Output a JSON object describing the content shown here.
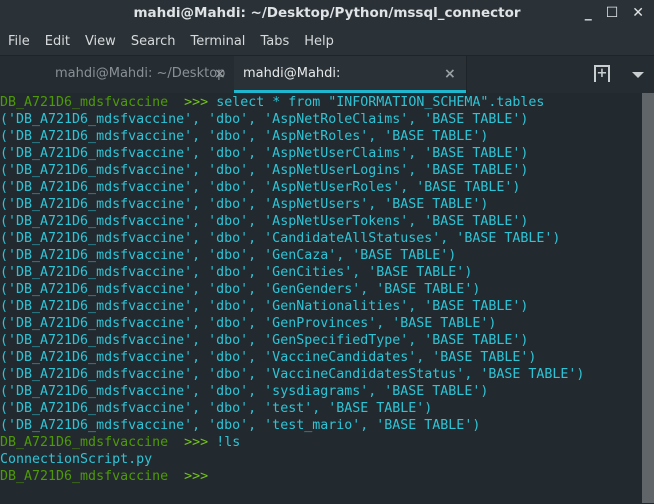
{
  "window": {
    "title": "mahdi@Mahdi: ~/Desktop/Python/mssql_connector",
    "minimize": "_",
    "maximize": "☐",
    "close": "✕"
  },
  "menu": [
    "File",
    "Edit",
    "View",
    "Search",
    "Terminal",
    "Tabs",
    "Help"
  ],
  "tabs": [
    {
      "label": "mahdi@Mahdi: ~/Desktop",
      "active": false
    },
    {
      "label": "mahdi@Mahdi: ~/Desktop/Python/...",
      "active": true
    }
  ],
  "tab_close": "×",
  "new_tab_icon": "+",
  "colors": {
    "prompt": "#4e9a06",
    "arrow": "#73c21e",
    "output": "#2ec4d6",
    "accent": "#1fb7cf",
    "background": "#232a2f"
  },
  "terminal": {
    "prompt": "DB_A721D6_mdsfvaccine",
    "arrow": ">>>",
    "command1": "select * from \"INFORMATION_SCHEMA\".tables",
    "rows": [
      "('DB_A721D6_mdsfvaccine', 'dbo', 'AspNetRoleClaims', 'BASE TABLE')",
      "('DB_A721D6_mdsfvaccine', 'dbo', 'AspNetRoles', 'BASE TABLE')",
      "('DB_A721D6_mdsfvaccine', 'dbo', 'AspNetUserClaims', 'BASE TABLE')",
      "('DB_A721D6_mdsfvaccine', 'dbo', 'AspNetUserLogins', 'BASE TABLE')",
      "('DB_A721D6_mdsfvaccine', 'dbo', 'AspNetUserRoles', 'BASE TABLE')",
      "('DB_A721D6_mdsfvaccine', 'dbo', 'AspNetUsers', 'BASE TABLE')",
      "('DB_A721D6_mdsfvaccine', 'dbo', 'AspNetUserTokens', 'BASE TABLE')",
      "('DB_A721D6_mdsfvaccine', 'dbo', 'CandidateAllStatuses', 'BASE TABLE')",
      "('DB_A721D6_mdsfvaccine', 'dbo', 'GenCaza', 'BASE TABLE')",
      "('DB_A721D6_mdsfvaccine', 'dbo', 'GenCities', 'BASE TABLE')",
      "('DB_A721D6_mdsfvaccine', 'dbo', 'GenGenders', 'BASE TABLE')",
      "('DB_A721D6_mdsfvaccine', 'dbo', 'GenNationalities', 'BASE TABLE')",
      "('DB_A721D6_mdsfvaccine', 'dbo', 'GenProvinces', 'BASE TABLE')",
      "('DB_A721D6_mdsfvaccine', 'dbo', 'GenSpecifiedType', 'BASE TABLE')",
      "('DB_A721D6_mdsfvaccine', 'dbo', 'VaccineCandidates', 'BASE TABLE')",
      "('DB_A721D6_mdsfvaccine', 'dbo', 'VaccineCandidatesStatus', 'BASE TABLE')",
      "('DB_A721D6_mdsfvaccine', 'dbo', 'sysdiagrams', 'BASE TABLE')",
      "('DB_A721D6_mdsfvaccine', 'dbo', 'test', 'BASE TABLE')",
      "('DB_A721D6_mdsfvaccine', 'dbo', 'test_mario', 'BASE TABLE')"
    ],
    "command2": "!ls",
    "ls_output": "ConnectionScript.py"
  }
}
